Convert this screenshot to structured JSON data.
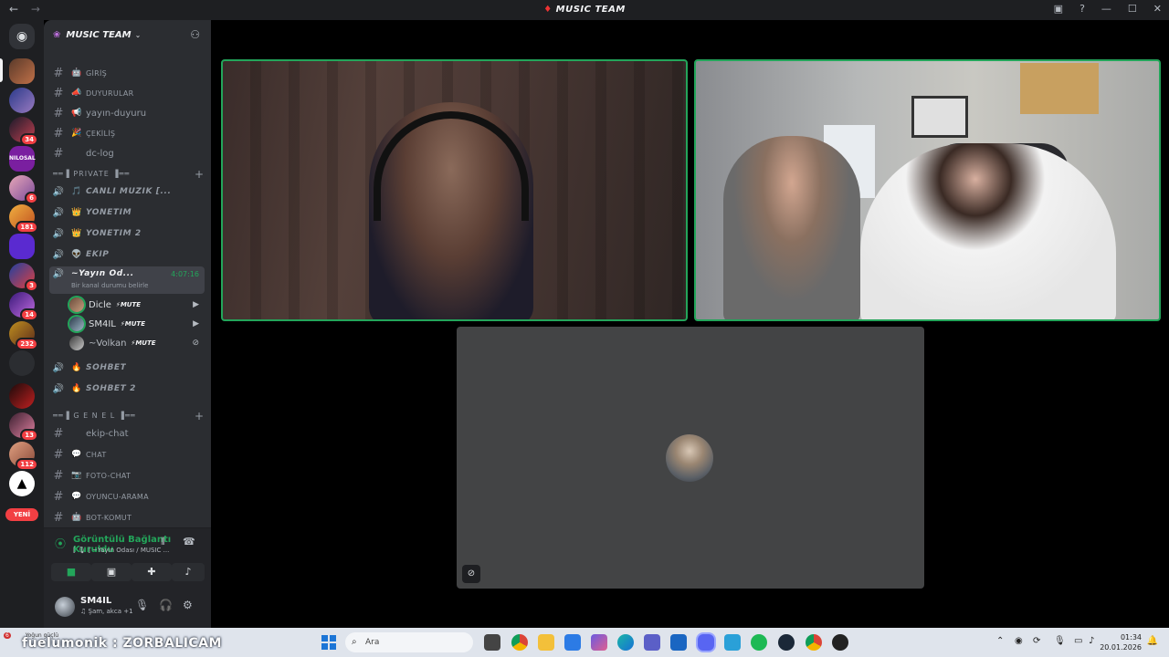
{
  "window": {
    "title": "MUSIC TEAM",
    "back": "←",
    "forward": "→"
  },
  "servers": {
    "badges": [
      "34",
      "6",
      "181",
      "3",
      "14",
      "232",
      "13",
      "112"
    ],
    "nilosal_label": "NILOSAL",
    "new_label": "YENİ"
  },
  "guild": {
    "name": "MUSIC TEAM"
  },
  "channels": [
    {
      "type": "text",
      "icon": "🤖",
      "label": "GİRİŞ",
      "small": true
    },
    {
      "type": "text",
      "icon": "📣",
      "label": "DUYURULAR",
      "small": true
    },
    {
      "type": "text",
      "icon": "📢",
      "label": "yayın-duyuru",
      "small": false
    },
    {
      "type": "text",
      "icon": "🎉",
      "label": "ÇEKİLİŞ",
      "small": true
    },
    {
      "type": "text",
      "icon": "",
      "label": "dc-log",
      "small": false
    }
  ],
  "categories": {
    "private": "══▐ PRIVATE ▐══",
    "genel": "══▐ G E N E L ▐══"
  },
  "voice_channels": [
    {
      "icon": "🎵",
      "label": "CANLI MUZIK [..."
    },
    {
      "icon": "👑",
      "label": "YÖNETİM"
    },
    {
      "icon": "👑",
      "label": "YÖNETİM 2"
    },
    {
      "icon": "👽",
      "label": "EKİP"
    }
  ],
  "active_voice": {
    "label": "~Yayın Od...",
    "timer": "4:07:16",
    "status": "Bir kanal durumu belirle"
  },
  "voice_users": [
    {
      "name": "Dicle",
      "tag": "MUTE",
      "right": "▶"
    },
    {
      "name": "SM4IL",
      "tag": "MUTE",
      "right": "▶"
    },
    {
      "name": "~Volkan",
      "tag": "MUTE",
      "right": "⊘"
    }
  ],
  "voice_channels_2": [
    {
      "icon": "🔥",
      "label": "SOHBET"
    },
    {
      "icon": "🔥",
      "label": "SOHBET 2"
    }
  ],
  "text_channels_2": [
    {
      "icon": "",
      "label": "ekip-chat",
      "small": false
    },
    {
      "icon": "💬",
      "label": "CHAT",
      "small": true
    },
    {
      "icon": "📷",
      "label": "FOTO-CHAT",
      "small": true
    },
    {
      "icon": "💬",
      "label": "OYUNCU-ARAMA",
      "small": true
    },
    {
      "icon": "🤖",
      "label": "BOT-KOMUT",
      "small": true
    }
  ],
  "voice_panel": {
    "status": "Görüntülü Bağlantı Kuruldu",
    "channel": "[ 🎙 ] ~Yayın Odası / MUSIC ..."
  },
  "user": {
    "name": "SM4IL",
    "status": "♫ Şam, akca +1"
  },
  "taskbar": {
    "news_count": "6",
    "news": "Yoğun güçlü",
    "ticker": "fuelumonik : ZORBALICAM",
    "search_placeholder": "Ara",
    "time": "01:34",
    "date": "20.01.2026"
  },
  "colors": {
    "speaking": "#23a55a",
    "danger": "#f23f43",
    "sidebar": "#2b2d31",
    "rail": "#1e1f22"
  }
}
